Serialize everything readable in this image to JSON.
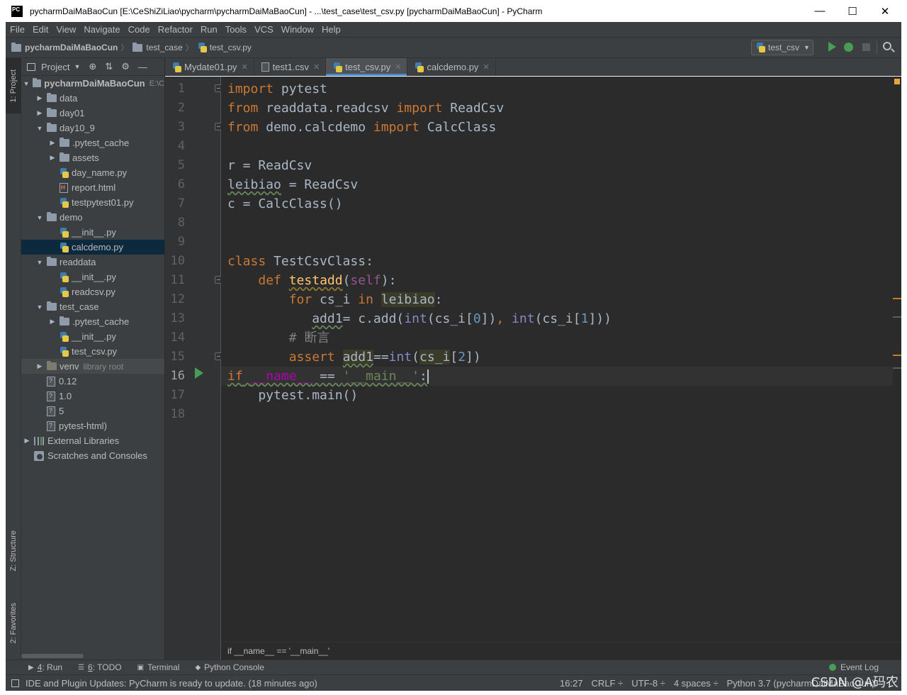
{
  "window": {
    "title": "pycharmDaiMaBaoCun [E:\\CeShiZiLiao\\pycharm\\pycharmDaiMaBaoCun] - ...\\test_case\\test_csv.py [pycharmDaiMaBaoCun] - PyCharm",
    "logo_text": "PC",
    "minimize": "—",
    "maximize": "☐",
    "close": "✕"
  },
  "menu": [
    "File",
    "Edit",
    "View",
    "Navigate",
    "Code",
    "Refactor",
    "Run",
    "Tools",
    "VCS",
    "Window",
    "Help"
  ],
  "navbar": {
    "crumbs": [
      "pycharmDaiMaBaoCun",
      "test_case",
      "test_csv.py"
    ],
    "run_config": "test_csv"
  },
  "toolstrip": {
    "project": "1: Project",
    "structure": "Z: Structure",
    "favorites": "2: Favorites"
  },
  "project": {
    "header": "Project",
    "tree": [
      {
        "label": "pycharmDaiMaBaoCun",
        "path": "E:\\C",
        "type": "folder",
        "indent": 0,
        "arrow": "▼",
        "bold": true
      },
      {
        "label": "data",
        "type": "folder",
        "indent": 1,
        "arrow": "▶"
      },
      {
        "label": "day01",
        "type": "folder",
        "indent": 1,
        "arrow": "▶"
      },
      {
        "label": "day10_9",
        "type": "folder",
        "indent": 1,
        "arrow": "▼"
      },
      {
        "label": ".pytest_cache",
        "type": "folder",
        "indent": 2,
        "arrow": "▶"
      },
      {
        "label": "assets",
        "type": "folder",
        "indent": 2,
        "arrow": "▶"
      },
      {
        "label": "day_name.py",
        "type": "py",
        "indent": 2
      },
      {
        "label": "report.html",
        "type": "html",
        "indent": 2
      },
      {
        "label": "testpytest01.py",
        "type": "py",
        "indent": 2
      },
      {
        "label": "demo",
        "type": "folder",
        "indent": 1,
        "arrow": "▼"
      },
      {
        "label": "__init__.py",
        "type": "py",
        "indent": 2
      },
      {
        "label": "calcdemo.py",
        "type": "py",
        "indent": 2,
        "selected": true
      },
      {
        "label": "readdata",
        "type": "folder",
        "indent": 1,
        "arrow": "▼"
      },
      {
        "label": "__init__.py",
        "type": "py",
        "indent": 2
      },
      {
        "label": "readcsv.py",
        "type": "py",
        "indent": 2
      },
      {
        "label": "test_case",
        "type": "folder",
        "indent": 1,
        "arrow": "▼"
      },
      {
        "label": ".pytest_cache",
        "type": "folder",
        "indent": 2,
        "arrow": "▶"
      },
      {
        "label": "__init__.py",
        "type": "py",
        "indent": 2
      },
      {
        "label": "test_csv.py",
        "type": "py",
        "indent": 2
      },
      {
        "label": "venv",
        "suffix": "library root",
        "type": "folder-excl",
        "indent": 1,
        "arrow": "▶",
        "shaded": true
      },
      {
        "label": "0.12",
        "type": "file",
        "indent": 1
      },
      {
        "label": "1.0",
        "type": "file",
        "indent": 1
      },
      {
        "label": "5",
        "type": "file",
        "indent": 1
      },
      {
        "label": "pytest-html)",
        "type": "file",
        "indent": 1
      },
      {
        "label": "External Libraries",
        "type": "lib",
        "indent": 0,
        "arrow": "▶"
      },
      {
        "label": "Scratches and Consoles",
        "type": "scratch",
        "indent": 0
      }
    ]
  },
  "tabs": [
    {
      "label": "Mydate01.py",
      "icon": "py"
    },
    {
      "label": "test1.csv",
      "icon": "csv"
    },
    {
      "label": "test_csv.py",
      "icon": "py",
      "active": true
    },
    {
      "label": "calcdemo.py",
      "icon": "py"
    }
  ],
  "editor": {
    "line_numbers": [
      "1",
      "2",
      "3",
      "4",
      "5",
      "6",
      "7",
      "8",
      "9",
      "10",
      "11",
      "12",
      "13",
      "14",
      "15",
      "16",
      "17",
      "18"
    ],
    "current_line": "16",
    "breadcrumb": "if __name__ == '__main__'"
  },
  "bottom_tabs": [
    {
      "num": "4",
      "label": ": Run",
      "icon": "▶"
    },
    {
      "num": "6",
      "label": ": TODO",
      "icon": "☰"
    },
    {
      "num": "",
      "label": "Terminal",
      "icon": "▣"
    },
    {
      "num": "",
      "label": "Python Console",
      "icon": "◆"
    }
  ],
  "event_log": "Event Log",
  "status": {
    "message": "IDE and Plugin Updates: PyCharm is ready to update. (18 minutes ago)",
    "position": "16:27",
    "line_sep": "CRLF ÷",
    "encoding": "UTF-8 ÷",
    "indent": "4 spaces ÷",
    "interpreter": "Python 3.7 (pycharmDaiMaBaoCun)"
  },
  "watermark": "CSDN @A码农"
}
